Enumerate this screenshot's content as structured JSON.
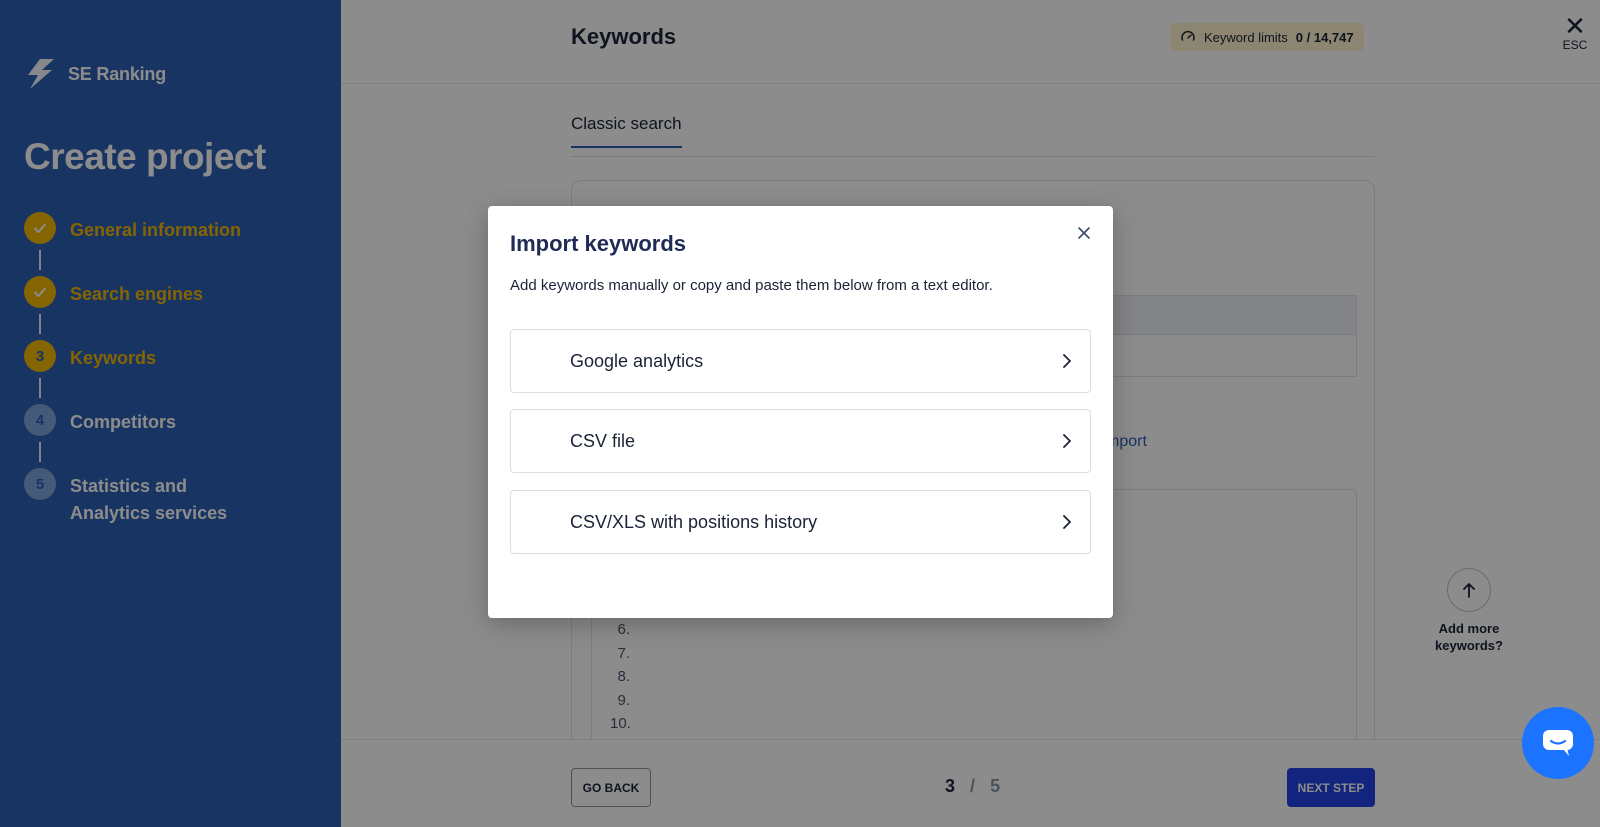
{
  "sidebar": {
    "brand": "SE Ranking",
    "title": "Create project",
    "steps": [
      {
        "marker": "",
        "label": "General information"
      },
      {
        "marker": "",
        "label": "Search engines"
      },
      {
        "marker": "3",
        "label": "Keywords"
      },
      {
        "marker": "4",
        "label": "Competitors"
      },
      {
        "marker": "5",
        "label": "Statistics and Analytics services"
      }
    ]
  },
  "header": {
    "title": "Keywords",
    "limits_label": "Keyword limits",
    "limits_value": "0 / 14,747",
    "esc_label": "ESC"
  },
  "tabs": [
    {
      "label": "Classic search"
    }
  ],
  "panel": {
    "import_text": "mport",
    "line_numbers": [
      "6.",
      "7.",
      "8.",
      "9.",
      "10."
    ]
  },
  "add_more": {
    "label": "Add more keywords?"
  },
  "footer": {
    "back_label": "GO BACK",
    "page_current": "3",
    "page_sep": "/",
    "page_total": "5",
    "next_label": "NEXT STEP"
  },
  "modal": {
    "title": "Import keywords",
    "description": "Add keywords manually or copy and paste them below from a text editor.",
    "options": [
      {
        "label": "Google analytics"
      },
      {
        "label": "CSV file"
      },
      {
        "label": "CSV/XLS with positions history"
      }
    ]
  },
  "colors": {
    "sidebar_bg": "#2c5fb3",
    "accent_yellow": "#f2b705",
    "primary_button": "#2342e8",
    "chat_bubble": "#1b73ff"
  },
  "icons": {
    "brand": "se-ranking-logo-icon",
    "done_step": "check-icon",
    "limits": "gauge-icon",
    "close": "close-icon",
    "up": "arrow-up-icon",
    "option": "chevron-right-icon",
    "chat": "chat-icon"
  }
}
